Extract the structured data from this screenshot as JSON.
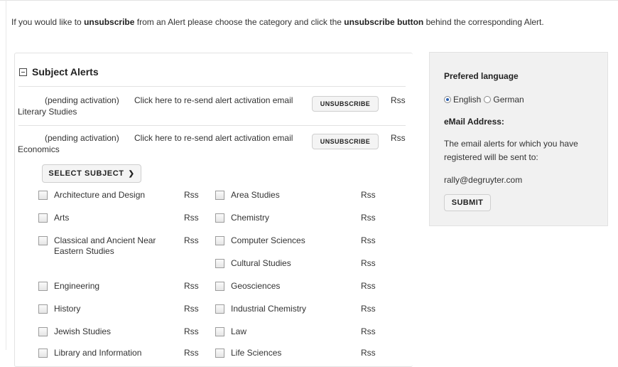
{
  "intro": {
    "part1": "If you would like to ",
    "bold1": "unsubscribe",
    "part2": " from an Alert please choose the category and click the ",
    "bold2": "unsubscribe button",
    "part3": " behind the corresponding Alert."
  },
  "panel": {
    "title": "Subject Alerts",
    "alerts": [
      {
        "status": "(pending activation)",
        "resend": "Click here to re-send alert activation email",
        "category": "Literary Studies",
        "button": "UNSUBSCRIBE",
        "rss": "Rss"
      },
      {
        "status": "(pending activation)",
        "resend": "Click here to re-send alert activation email",
        "category": "Economics",
        "button": "UNSUBSCRIBE",
        "rss": "Rss"
      }
    ],
    "select_subject": "SELECT SUBJECT",
    "rss_label": "Rss",
    "subjects_left": [
      "Architecture and Design",
      "Arts",
      "Classical and Ancient Near Eastern Studies",
      "Engineering",
      "History",
      "Jewish Studies",
      "Library and Information"
    ],
    "subjects_right": [
      "Area Studies",
      "Chemistry",
      "Computer Sciences",
      "Cultural Studies",
      "Geosciences",
      "Industrial Chemistry",
      "Law",
      "Life Sciences"
    ]
  },
  "sidebar": {
    "language_heading": "Prefered language",
    "languages": [
      "English",
      "German"
    ],
    "selected_language": "English",
    "email_heading": "eMail Address:",
    "description": "The email alerts for which you have registered will be sent to:",
    "email": "rally@degruyter.com",
    "submit": "SUBMIT"
  },
  "colors": {
    "radio_selected": "#2a5fb0",
    "sidebar_bg": "#f1f1f1"
  }
}
